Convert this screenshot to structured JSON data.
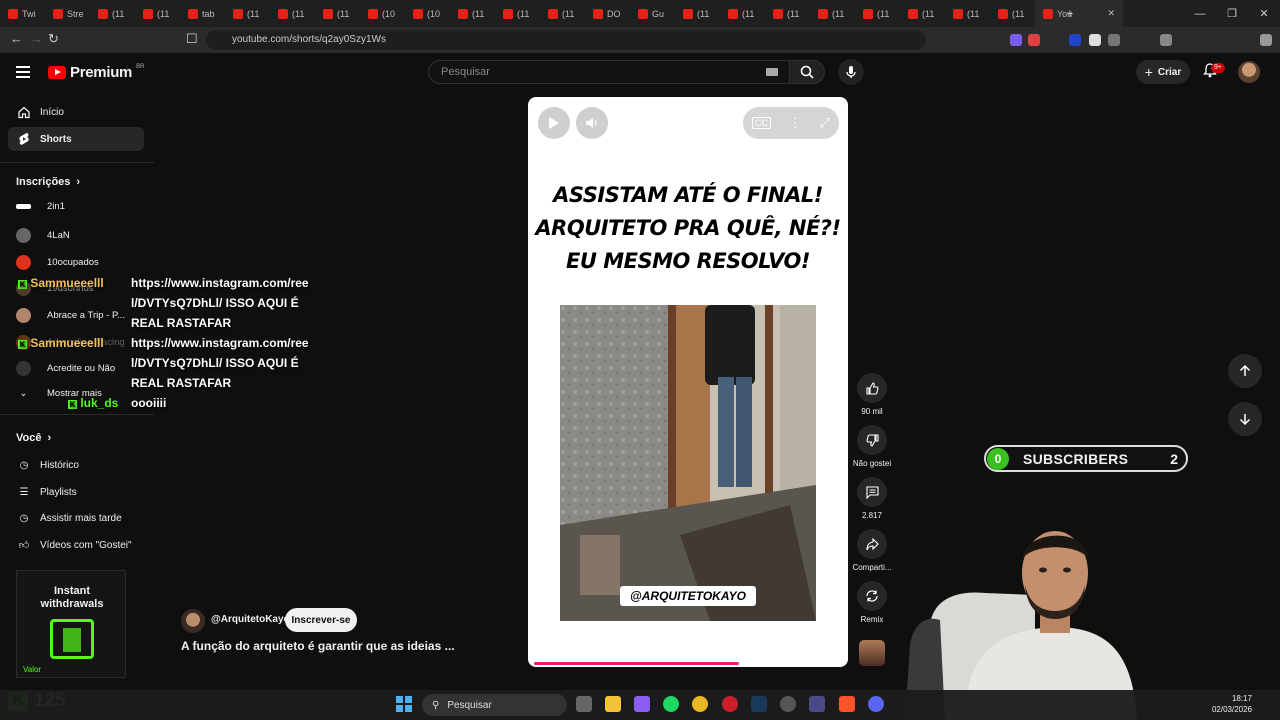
{
  "browser": {
    "tabs": [
      "Twi",
      "Stre",
      "(11",
      "(11",
      "tab",
      "(11",
      "(11",
      "(11",
      "(10",
      "(10",
      "(11",
      "(11",
      "(11",
      "DO",
      "Gu",
      "(11",
      "(11",
      "(11",
      "(11",
      "(11",
      "(11",
      "(11",
      "(11"
    ],
    "active_tab": "You",
    "url": "youtube.com/shorts/q2ay0Szy1Ws"
  },
  "header": {
    "logo": "Premium",
    "region": "BR",
    "search_placeholder": "Pesquisar",
    "create_label": "Criar",
    "notifications_badge": "9+"
  },
  "sidebar": {
    "main": [
      {
        "label": "Início",
        "icon": "home-icon"
      },
      {
        "label": "Shorts",
        "icon": "shorts-icon"
      }
    ],
    "subscriptions_title": "Inscrições",
    "channels": [
      "2in1",
      "4LaN",
      "10ocupados",
      "19dsonhos",
      "Abrace a Trip - P...",
      "Adrenalina Racing",
      "Acredite ou Não"
    ],
    "show_more": "Mostrar mais",
    "you_title": "Você",
    "you_items": [
      "Histórico",
      "Playlists",
      "Assistir mais tarde",
      "Vídeos com \"Gostei\""
    ]
  },
  "chat": [
    {
      "user": "Sammueeelll",
      "message": "https://www.instagram.com/ree l/DVTYsQ7DhLl/ ISSO AQUI É REAL RASTAFAR"
    },
    {
      "user": "Sammueeelll",
      "message": "https://www.instagram.com/ree l/DVTYsQ7DhLl/ ISSO AQUI É REAL RASTAFAR"
    },
    {
      "user": "luk_ds",
      "message": "oooiiii"
    }
  ],
  "chat_lines_1": [
    "https://www.instagram.com/ree",
    "l/DVTYsQ7DhLl/ ISSO AQUI É",
    "REAL RASTAFAR"
  ],
  "short": {
    "overlay_title": [
      "ASSISTAM ATÉ O FINAL!",
      "ARQUITETO PRA QUÊ, NÉ?!",
      "EU MESMO RESOLVO!"
    ],
    "watermark": "@ARQUITETOKAYO",
    "progress": 0.66
  },
  "actions": {
    "likes": "90 mil",
    "dislike": "Não gostei",
    "comments": "2.817",
    "share": "Comparti...",
    "remix": "Remix"
  },
  "channel": {
    "name": "@ArquitetoKayo",
    "subscribe": "Inscrever-se",
    "description": "A função do arquiteto é garantir que as ideias ..."
  },
  "subs_widget": {
    "left": "0",
    "label": "SUBSCRIBERS",
    "right": "2"
  },
  "ad": {
    "title_1": "Instant",
    "title_2": "withdrawals",
    "footer": "Valor"
  },
  "kick": {
    "count": "125"
  },
  "taskbar": {
    "search": "Pesquisar",
    "time": "18:17",
    "date": "02/03/2026"
  },
  "colors": {
    "yt_red": "#ff0000",
    "kick_green": "#53fc18",
    "progress_pink": "#e91e63"
  }
}
